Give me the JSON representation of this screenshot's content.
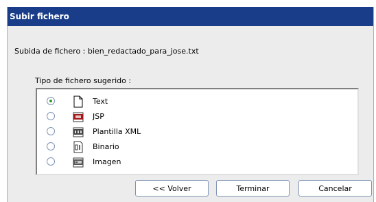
{
  "dialog": {
    "title": "Subir fichero",
    "file_line": "Subida de fichero : bien_redactado_para_jose.txt",
    "type_label": "Tipo de fichero sugerido :"
  },
  "options": [
    {
      "label": "Text",
      "icon": "text-file-icon",
      "selected": true
    },
    {
      "label": "JSP",
      "icon": "jsp-file-icon",
      "selected": false
    },
    {
      "label": "Plantilla XML",
      "icon": "xml-template-icon",
      "selected": false
    },
    {
      "label": "Binario",
      "icon": "binary-file-icon",
      "selected": false
    },
    {
      "label": "Imagen",
      "icon": "image-file-icon",
      "selected": false
    }
  ],
  "buttons": {
    "back": "<< Volver",
    "finish": "Terminar",
    "cancel": "Cancelar"
  },
  "colors": {
    "titlebar": "#1a3d8a",
    "panel": "#ececec",
    "radio_selected": "#2f9a2f"
  }
}
